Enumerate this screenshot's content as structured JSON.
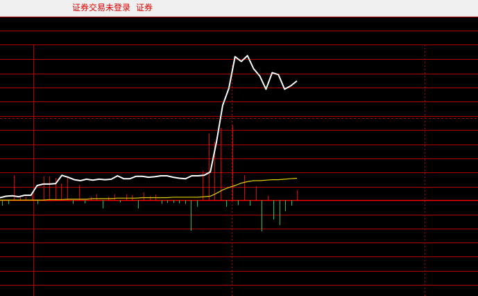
{
  "status_bar": {
    "login_status": "证券交易未登录",
    "market_label": "证券"
  },
  "colors": {
    "background": "#000000",
    "grid": "#b00000",
    "zero_line": "#ff0000",
    "price_line": "#ffffff",
    "average_line": "#e6d200",
    "up_bar": "#e00000",
    "down_bar": "#00cc66",
    "status_text": "#e00000"
  },
  "chart_data": {
    "type": "line",
    "title": "",
    "grid": true,
    "ylim": [
      -1.0,
      1.0
    ],
    "series": [
      {
        "values": [
          0.05,
          0.08,
          0.09,
          0.07,
          0.1,
          0.1,
          0.3,
          0.33,
          0.33,
          0.34,
          0.51,
          0.47,
          0.42,
          0.4,
          0.43,
          0.41,
          0.43,
          0.42,
          0.43,
          0.5,
          0.44,
          0.44,
          0.49,
          0.49,
          0.47,
          0.48,
          0.5,
          0.5,
          0.47,
          0.45,
          0.44,
          0.5,
          0.5,
          0.51,
          0.58,
          1.2,
          1.95,
          2.3,
          2.95,
          2.85,
          2.97,
          2.7,
          2.55,
          2.28,
          2.62,
          2.58,
          2.28,
          2.35,
          2.45
        ]
      },
      {
        "values": [
          0.0,
          0.0,
          0.0,
          0.0,
          0.0,
          0.0,
          0.0,
          0.0,
          0.01,
          0.01,
          0.01,
          0.02,
          0.02,
          0.02,
          0.02,
          0.03,
          0.03,
          0.03,
          0.03,
          0.04,
          0.04,
          0.04,
          0.04,
          0.05,
          0.05,
          0.05,
          0.05,
          0.05,
          0.06,
          0.06,
          0.06,
          0.06,
          0.06,
          0.07,
          0.08,
          0.14,
          0.21,
          0.26,
          0.3,
          0.35,
          0.38,
          0.4,
          0.4,
          0.41,
          0.42,
          0.42,
          0.43,
          0.44,
          0.45
        ]
      }
    ],
    "bars": [
      -0.1,
      -0.07,
      0.45,
      0.06,
      0.06,
      0.12,
      -0.07,
      0.43,
      0.43,
      0.4,
      0.3,
      0.43,
      -0.07,
      0.27,
      -0.06,
      0.06,
      0.11,
      -0.15,
      0.06,
      0.11,
      -0.04,
      0.11,
      0.09,
      -0.15,
      0.14,
      0.07,
      0.1,
      -0.07,
      -0.05,
      -0.05,
      -0.06,
      -0.07,
      -0.55,
      -0.12,
      0.53,
      1.2,
      1.05,
      1.3,
      -0.12,
      1.35,
      -0.09,
      0.45,
      -0.1,
      0.25,
      -0.56,
      0.08,
      -0.35,
      -0.45,
      -0.2,
      -0.1,
      0.18
    ]
  }
}
